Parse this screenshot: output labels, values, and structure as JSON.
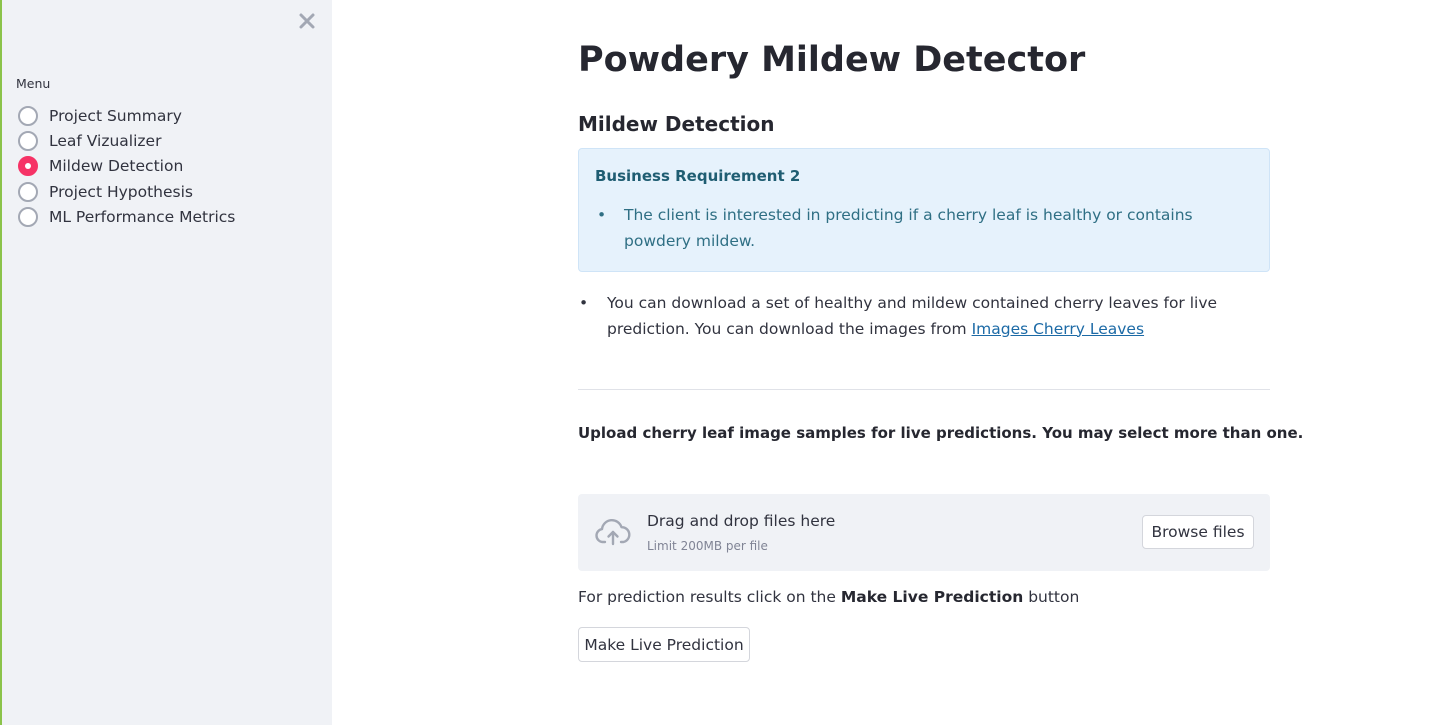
{
  "sidebar": {
    "menu_label": "Menu",
    "close_icon": "close-icon",
    "items": [
      {
        "label": "Project Summary",
        "selected": false
      },
      {
        "label": "Leaf Vizualizer",
        "selected": false
      },
      {
        "label": "Mildew Detection",
        "selected": true
      },
      {
        "label": "Project Hypothesis",
        "selected": false
      },
      {
        "label": "ML Performance Metrics",
        "selected": false
      }
    ],
    "accent_color": "#f63366"
  },
  "main": {
    "title": "Powdery Mildew Detector",
    "section_title": "Mildew Detection",
    "info_box": {
      "title": "Business Requirement 2",
      "bullet": "The client is interested in predicting if a cherry leaf is healthy or contains powdery mildew."
    },
    "download": {
      "text": "You can download a set of healthy and mildew contained cherry leaves for live prediction. You can download the images from ",
      "link_text": "Images Cherry Leaves"
    },
    "upload": {
      "heading": "Upload cherry leaf image samples for live predictions. You may select more than one.",
      "drop_title": "Drag and drop files here",
      "drop_limit": "Limit 200MB per file",
      "browse_label": "Browse files",
      "icon": "cloud-upload-icon"
    },
    "hint": {
      "prefix": "For prediction results click on the ",
      "bold": "Make Live Prediction",
      "suffix": " button"
    },
    "predict_button_label": "Make Live Prediction"
  }
}
